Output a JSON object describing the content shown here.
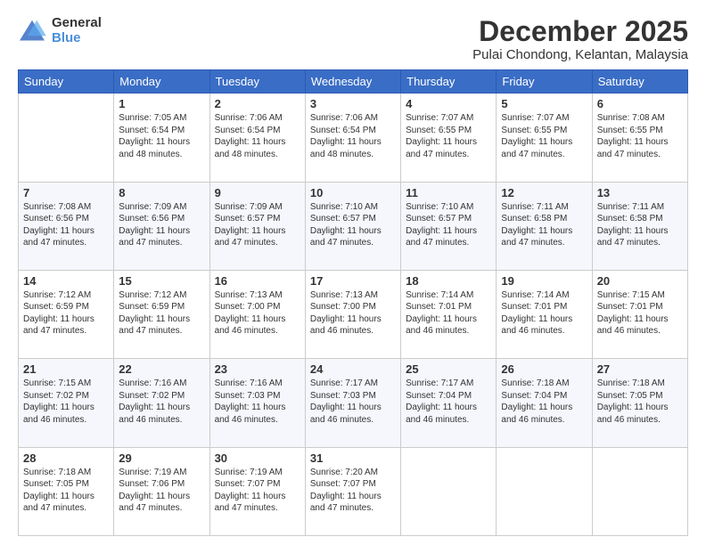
{
  "header": {
    "logo_line1": "General",
    "logo_line2": "Blue",
    "title": "December 2025",
    "subtitle": "Pulai Chondong, Kelantan, Malaysia"
  },
  "days_of_week": [
    "Sunday",
    "Monday",
    "Tuesday",
    "Wednesday",
    "Thursday",
    "Friday",
    "Saturday"
  ],
  "weeks": [
    [
      {
        "day": "",
        "info": ""
      },
      {
        "day": "1",
        "info": "Sunrise: 7:05 AM\nSunset: 6:54 PM\nDaylight: 11 hours\nand 48 minutes."
      },
      {
        "day": "2",
        "info": "Sunrise: 7:06 AM\nSunset: 6:54 PM\nDaylight: 11 hours\nand 48 minutes."
      },
      {
        "day": "3",
        "info": "Sunrise: 7:06 AM\nSunset: 6:54 PM\nDaylight: 11 hours\nand 48 minutes."
      },
      {
        "day": "4",
        "info": "Sunrise: 7:07 AM\nSunset: 6:55 PM\nDaylight: 11 hours\nand 47 minutes."
      },
      {
        "day": "5",
        "info": "Sunrise: 7:07 AM\nSunset: 6:55 PM\nDaylight: 11 hours\nand 47 minutes."
      },
      {
        "day": "6",
        "info": "Sunrise: 7:08 AM\nSunset: 6:55 PM\nDaylight: 11 hours\nand 47 minutes."
      }
    ],
    [
      {
        "day": "7",
        "info": "Sunrise: 7:08 AM\nSunset: 6:56 PM\nDaylight: 11 hours\nand 47 minutes."
      },
      {
        "day": "8",
        "info": "Sunrise: 7:09 AM\nSunset: 6:56 PM\nDaylight: 11 hours\nand 47 minutes."
      },
      {
        "day": "9",
        "info": "Sunrise: 7:09 AM\nSunset: 6:57 PM\nDaylight: 11 hours\nand 47 minutes."
      },
      {
        "day": "10",
        "info": "Sunrise: 7:10 AM\nSunset: 6:57 PM\nDaylight: 11 hours\nand 47 minutes."
      },
      {
        "day": "11",
        "info": "Sunrise: 7:10 AM\nSunset: 6:57 PM\nDaylight: 11 hours\nand 47 minutes."
      },
      {
        "day": "12",
        "info": "Sunrise: 7:11 AM\nSunset: 6:58 PM\nDaylight: 11 hours\nand 47 minutes."
      },
      {
        "day": "13",
        "info": "Sunrise: 7:11 AM\nSunset: 6:58 PM\nDaylight: 11 hours\nand 47 minutes."
      }
    ],
    [
      {
        "day": "14",
        "info": "Sunrise: 7:12 AM\nSunset: 6:59 PM\nDaylight: 11 hours\nand 47 minutes."
      },
      {
        "day": "15",
        "info": "Sunrise: 7:12 AM\nSunset: 6:59 PM\nDaylight: 11 hours\nand 47 minutes."
      },
      {
        "day": "16",
        "info": "Sunrise: 7:13 AM\nSunset: 7:00 PM\nDaylight: 11 hours\nand 46 minutes."
      },
      {
        "day": "17",
        "info": "Sunrise: 7:13 AM\nSunset: 7:00 PM\nDaylight: 11 hours\nand 46 minutes."
      },
      {
        "day": "18",
        "info": "Sunrise: 7:14 AM\nSunset: 7:01 PM\nDaylight: 11 hours\nand 46 minutes."
      },
      {
        "day": "19",
        "info": "Sunrise: 7:14 AM\nSunset: 7:01 PM\nDaylight: 11 hours\nand 46 minutes."
      },
      {
        "day": "20",
        "info": "Sunrise: 7:15 AM\nSunset: 7:01 PM\nDaylight: 11 hours\nand 46 minutes."
      }
    ],
    [
      {
        "day": "21",
        "info": "Sunrise: 7:15 AM\nSunset: 7:02 PM\nDaylight: 11 hours\nand 46 minutes."
      },
      {
        "day": "22",
        "info": "Sunrise: 7:16 AM\nSunset: 7:02 PM\nDaylight: 11 hours\nand 46 minutes."
      },
      {
        "day": "23",
        "info": "Sunrise: 7:16 AM\nSunset: 7:03 PM\nDaylight: 11 hours\nand 46 minutes."
      },
      {
        "day": "24",
        "info": "Sunrise: 7:17 AM\nSunset: 7:03 PM\nDaylight: 11 hours\nand 46 minutes."
      },
      {
        "day": "25",
        "info": "Sunrise: 7:17 AM\nSunset: 7:04 PM\nDaylight: 11 hours\nand 46 minutes."
      },
      {
        "day": "26",
        "info": "Sunrise: 7:18 AM\nSunset: 7:04 PM\nDaylight: 11 hours\nand 46 minutes."
      },
      {
        "day": "27",
        "info": "Sunrise: 7:18 AM\nSunset: 7:05 PM\nDaylight: 11 hours\nand 46 minutes."
      }
    ],
    [
      {
        "day": "28",
        "info": "Sunrise: 7:18 AM\nSunset: 7:05 PM\nDaylight: 11 hours\nand 47 minutes."
      },
      {
        "day": "29",
        "info": "Sunrise: 7:19 AM\nSunset: 7:06 PM\nDaylight: 11 hours\nand 47 minutes."
      },
      {
        "day": "30",
        "info": "Sunrise: 7:19 AM\nSunset: 7:07 PM\nDaylight: 11 hours\nand 47 minutes."
      },
      {
        "day": "31",
        "info": "Sunrise: 7:20 AM\nSunset: 7:07 PM\nDaylight: 11 hours\nand 47 minutes."
      },
      {
        "day": "",
        "info": ""
      },
      {
        "day": "",
        "info": ""
      },
      {
        "day": "",
        "info": ""
      }
    ]
  ]
}
